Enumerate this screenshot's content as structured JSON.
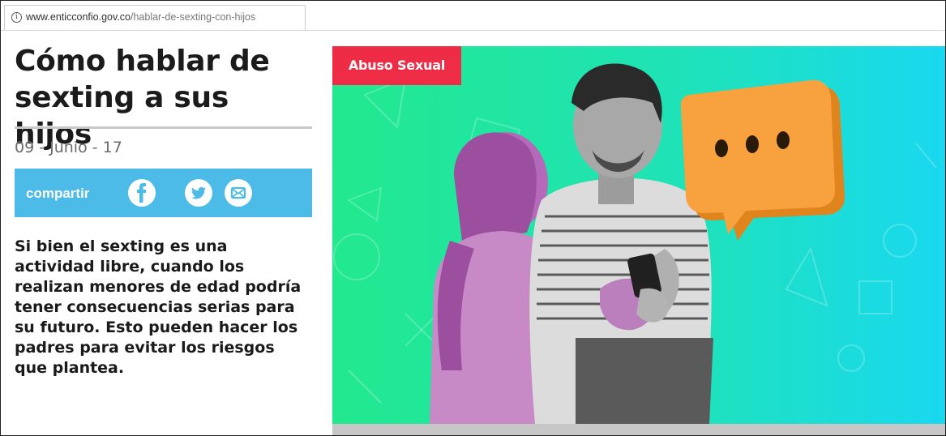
{
  "browser": {
    "url_host": "www.enticconfio.gov.co",
    "url_path": "/hablar-de-sexting-con-hijos",
    "info_glyph": "i"
  },
  "article": {
    "title": "Cómo hablar de sexting a sus hijos",
    "date": "09 - Junio - 17",
    "share_label": "compartir",
    "lead": "Si bien el sexting es una actividad libre, cuando los realizan menores de edad podría tener consecuencias serias para su futuro. Esto pueden hacer los padres para evitar los riesgos que plantea.",
    "category_badge": "Abuso Sexual"
  },
  "icons": {
    "share": [
      "facebook-icon",
      "twitter-icon",
      "email-icon"
    ],
    "speech_bubble": "speech-bubble-ellipsis-icon"
  },
  "colors": {
    "share_bar": "#4dbbe7",
    "badge": "#ef2c45",
    "hero_green": "#22e88e",
    "hero_cyan": "#19d8f0",
    "bubble": "#f7a23e"
  }
}
